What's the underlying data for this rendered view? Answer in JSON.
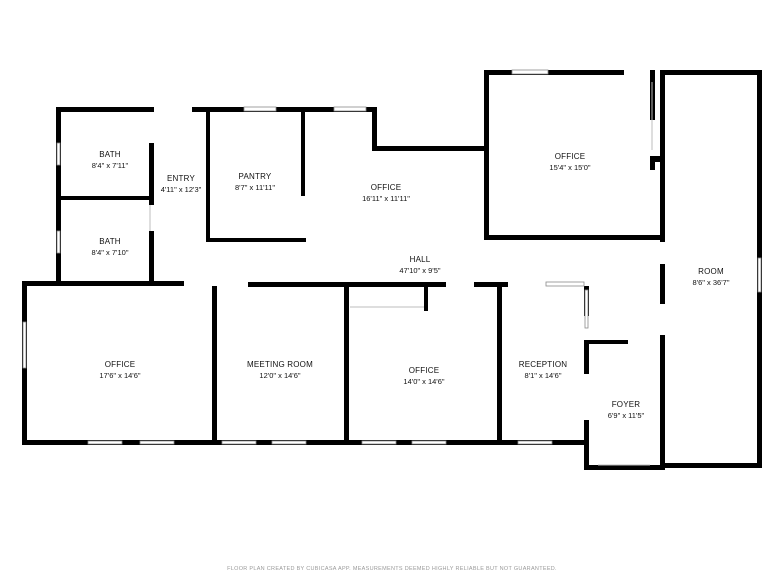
{
  "rooms": {
    "bath1": {
      "name": "BATH",
      "dim": "8'4\" x 7'11\""
    },
    "bath2": {
      "name": "BATH",
      "dim": "8'4\" x 7'10\""
    },
    "entry": {
      "name": "ENTRY",
      "dim": "4'11\" x 12'3\""
    },
    "pantry": {
      "name": "PANTRY",
      "dim": "8'7\" x 11'11\""
    },
    "office_top": {
      "name": "OFFICE",
      "dim": "16'11\" x 11'11\""
    },
    "office_top_right": {
      "name": "OFFICE",
      "dim": "15'4\" x 15'0\""
    },
    "hall": {
      "name": "HALL",
      "dim": "47'10\" x 9'5\""
    },
    "room": {
      "name": "ROOM",
      "dim": "8'6\" x 36'7\""
    },
    "office_bottom_left": {
      "name": "OFFICE",
      "dim": "17'6\" x 14'6\""
    },
    "meeting_room": {
      "name": "MEETING ROOM",
      "dim": "12'0\" x 14'6\""
    },
    "office_bottom_mid": {
      "name": "OFFICE",
      "dim": "14'0\" x 14'6\""
    },
    "reception": {
      "name": "RECEPTION",
      "dim": "8'1\" x 14'6\""
    },
    "foyer": {
      "name": "FOYER",
      "dim": "6'9\" x 11'5\""
    }
  },
  "footer": {
    "disclaimer": "FLOOR PLAN CREATED BY CUBICASA APP. MEASUREMENTS DEEMED HIGHLY RELIABLE BUT NOT GUARANTEED."
  },
  "colors": {
    "wall": "#000000",
    "background": "#ffffff",
    "window_frame": "#8a8a8a",
    "footer_text": "#9a9a9a"
  }
}
